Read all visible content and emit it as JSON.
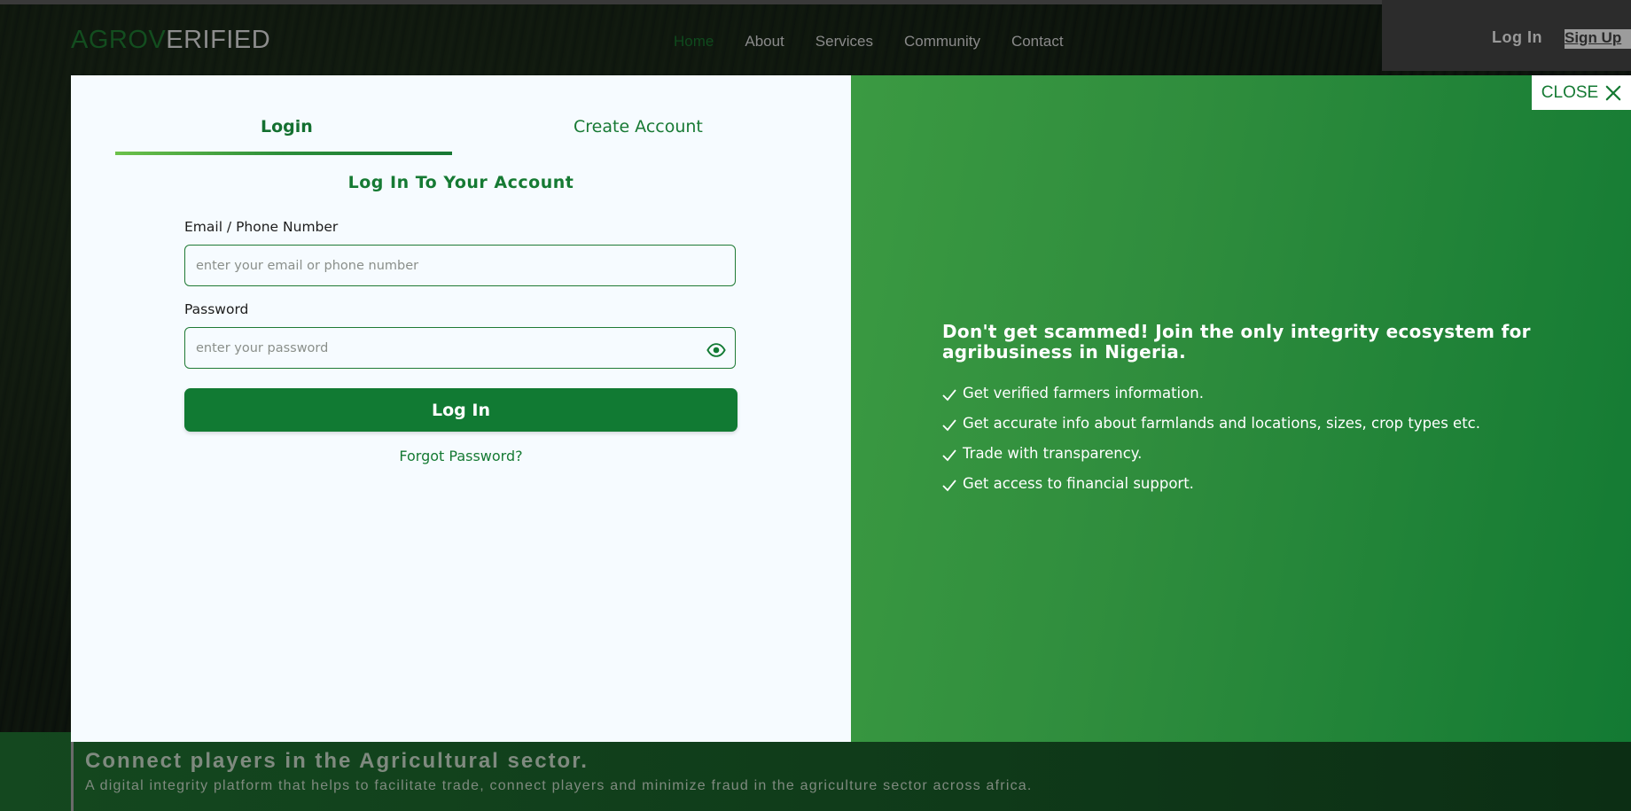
{
  "header": {
    "logo_part1": "AGROV",
    "logo_part2": "ERIFIED",
    "nav": [
      "Home",
      "About",
      "Services",
      "Community",
      "Contact"
    ],
    "login_label": "Log In",
    "signup_label": "Sign Up"
  },
  "banner": {
    "title": "Connect players in the Agricultural sector.",
    "subtitle": "A digital integrity platform that helps to facilitate trade, connect players and minimize fraud in the agriculture sector across africa."
  },
  "modal": {
    "tabs": {
      "login": "Login",
      "create": "Create Account"
    },
    "form_title": "Log In To Your Account",
    "email_label": "Email / Phone Number",
    "email_placeholder": "enter your email or phone number",
    "password_label": "Password",
    "password_placeholder": "enter your password",
    "submit_label": "Log In",
    "forgot_label": "Forgot Password?",
    "close_label": "CLOSE",
    "promo_title": "Don't get scammed! Join the only integrity ecosystem for agribusiness in Nigeria.",
    "benefits": [
      "Get verified farmers information.",
      "Get accurate info about farmlands and locations, sizes, crop types etc.",
      "Trade with transparency.",
      "Get access to financial support."
    ]
  },
  "colors": {
    "brand_green": "#117a33",
    "accent_light_green": "#3b9a42"
  },
  "icons": {
    "password_toggle": "eye-icon",
    "close": "close-icon",
    "benefit": "check-icon"
  }
}
